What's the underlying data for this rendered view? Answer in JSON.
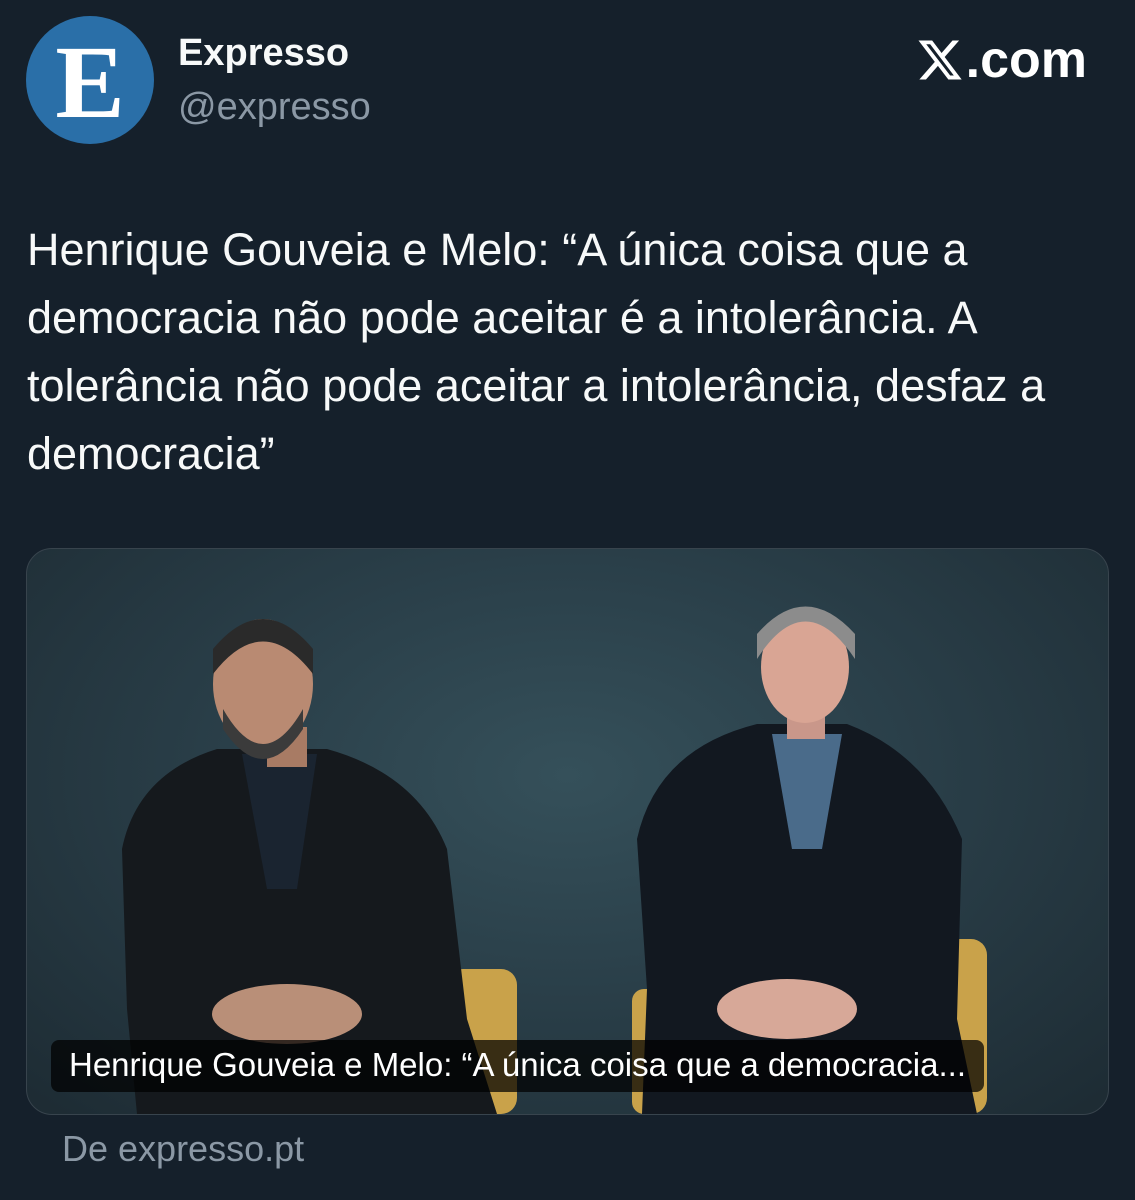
{
  "account": {
    "avatar_letter": "E",
    "display_name": "Expresso",
    "handle": "@expresso"
  },
  "brand": {
    "icon": "x-logo-icon",
    "text": ".com"
  },
  "tweet": {
    "text": "Henrique Gouveia e Melo: “A única coisa que a democracia não pode aceitar é a intolerância. A tolerância não pode aceitar a intolerância, desfaz a democracia”"
  },
  "card": {
    "caption": "Henrique Gouveia e Melo: “A única coisa que a democracia...",
    "source": "De expresso.pt"
  },
  "colors": {
    "background": "#15202b",
    "avatar": "#2a6fa8",
    "secondary_text": "#8b98a5"
  }
}
